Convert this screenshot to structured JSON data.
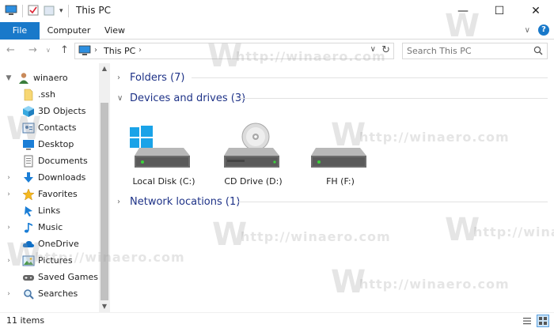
{
  "window": {
    "title": "This PC",
    "controls": {
      "minimize": "—",
      "maximize": "☐",
      "close": "✕"
    }
  },
  "ribbon": {
    "tabs": [
      "File",
      "Computer",
      "View"
    ]
  },
  "address": {
    "path": "This PC",
    "search_placeholder": "Search This PC"
  },
  "sidebar": {
    "items": [
      {
        "label": "winaero",
        "icon": "user-icon"
      },
      {
        "label": ".ssh",
        "icon": "folder-icon"
      },
      {
        "label": "3D Objects",
        "icon": "cube-icon"
      },
      {
        "label": "Contacts",
        "icon": "contacts-icon"
      },
      {
        "label": "Desktop",
        "icon": "desktop-icon"
      },
      {
        "label": "Documents",
        "icon": "documents-icon"
      },
      {
        "label": "Downloads",
        "icon": "download-icon"
      },
      {
        "label": "Favorites",
        "icon": "star-icon"
      },
      {
        "label": "Links",
        "icon": "link-icon"
      },
      {
        "label": "Music",
        "icon": "music-icon"
      },
      {
        "label": "OneDrive",
        "icon": "cloud-icon"
      },
      {
        "label": "Pictures",
        "icon": "pictures-icon"
      },
      {
        "label": "Saved Games",
        "icon": "games-icon"
      },
      {
        "label": "Searches",
        "icon": "search-icon"
      }
    ]
  },
  "groups": {
    "folders": "Folders (7)",
    "devices": "Devices and drives (3)",
    "network": "Network locations (1)"
  },
  "drives": [
    {
      "label": "Local Disk (C:)",
      "icon": "windows-drive-icon"
    },
    {
      "label": "CD Drive (D:)",
      "icon": "cd-drive-icon"
    },
    {
      "label": "FH (F:)",
      "icon": "drive-icon"
    }
  ],
  "status": {
    "items": "11 items"
  },
  "watermark": {
    "letter": "W",
    "url": "http://winaero.com"
  },
  "colors": {
    "accent": "#1979ca",
    "group_header": "#1e3287"
  }
}
